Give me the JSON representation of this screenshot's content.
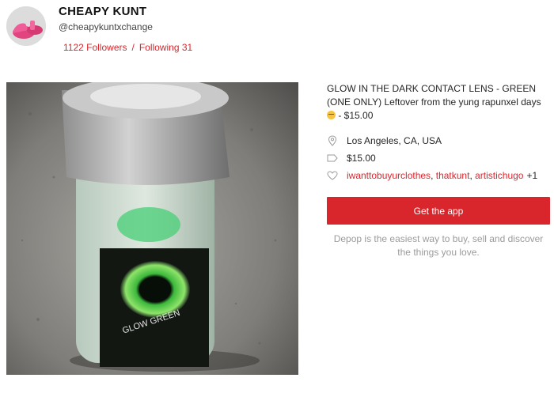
{
  "profile": {
    "name": "CHEAPY KUNT",
    "handle": "@cheapykuntxchange",
    "followers": "1122 Followers",
    "separator": "/",
    "following": "Following 31"
  },
  "product": {
    "title_main": "GLOW IN THE DARK CONTACT LENS - GREEN (ONE ONLY) Leftover from the yung rapunxel days",
    "title_price": " - $15.00",
    "emoji_icon": "relieved-face-emoji",
    "image_label": "GLOW GREEN",
    "location": "Los Angeles, CA, USA",
    "price": "$15.00",
    "likes": {
      "users": [
        "iwanttobuyurclothes",
        "thatkunt",
        "artistichugo"
      ],
      "more": "+1"
    }
  },
  "cta": {
    "label": "Get the app"
  },
  "tagline": "Depop is the easiest way to buy, sell and discover the things you love.",
  "colors": {
    "accent": "#d9262c",
    "muted": "#9b9b9b"
  },
  "icons": {
    "location": "map-pin-icon",
    "price": "price-tag-icon",
    "likes": "heart-icon"
  }
}
